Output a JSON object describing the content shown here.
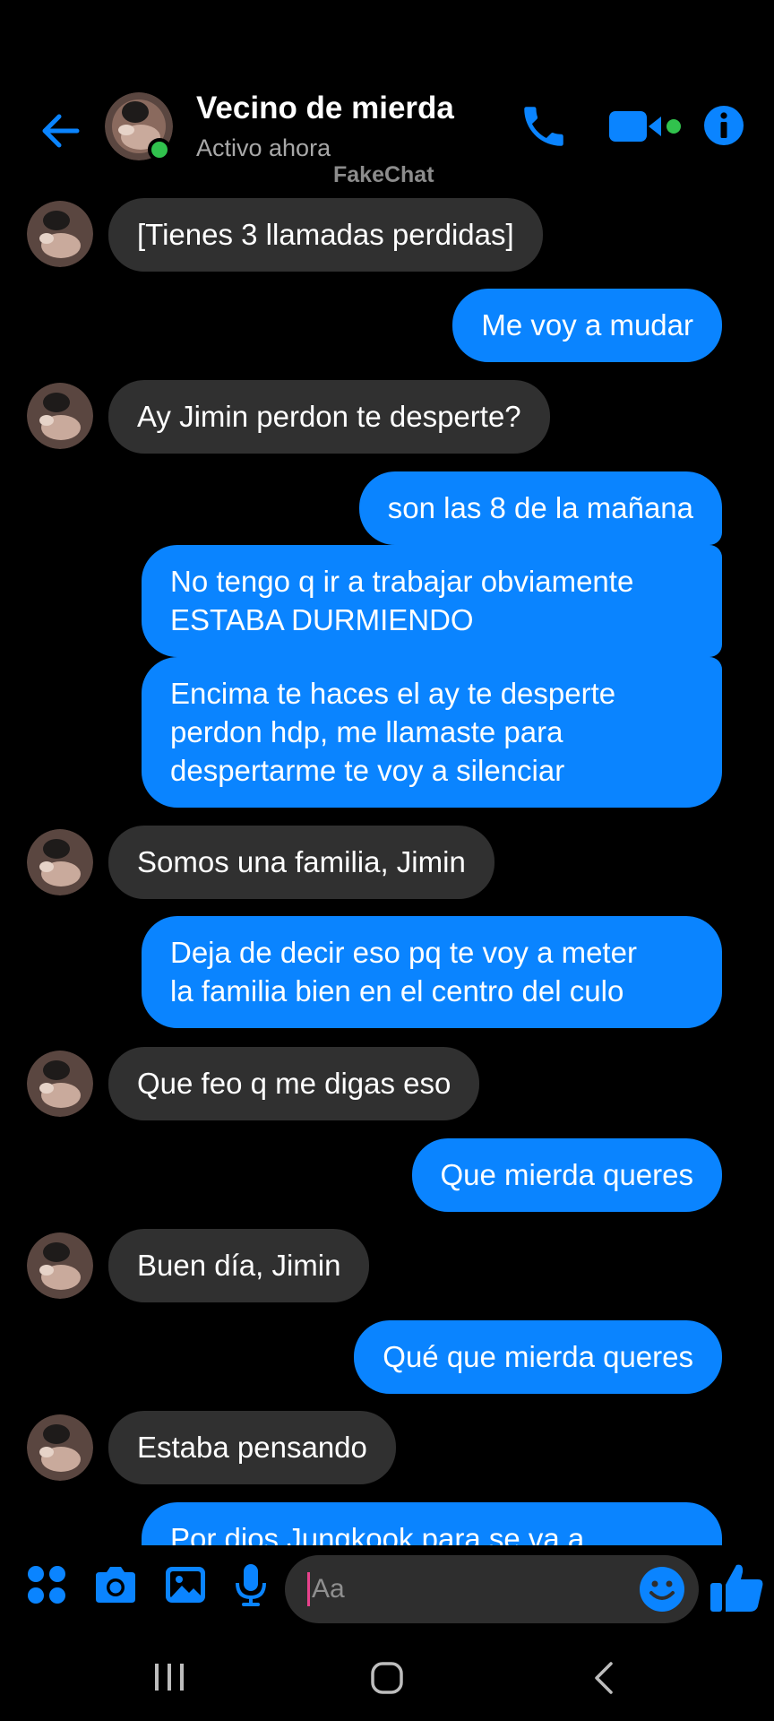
{
  "header": {
    "contact_name": "Vecino de mierda",
    "status": "Activo ahora",
    "watermark": "FakeChat"
  },
  "messages": [
    {
      "side": "in",
      "text": "[Tienes 3 llamadas perdidas]"
    },
    {
      "side": "out",
      "text": "Me voy a mudar"
    },
    {
      "side": "in",
      "text": "Ay Jimin perdon te desperte?"
    },
    {
      "side": "out",
      "text": "son las 8 de la mañana"
    },
    {
      "side": "out",
      "lines": [
        "No tengo q ir a trabajar obviamente",
        "ESTABA DURMIENDO"
      ]
    },
    {
      "side": "out",
      "lines": [
        "Encima te haces el ay te desperte",
        "perdon hdp, me llamaste para",
        "despertarme te voy a silenciar"
      ]
    },
    {
      "side": "in",
      "text": "Somos una familia, Jimin"
    },
    {
      "side": "out",
      "lines": [
        "Deja de decir eso pq te voy a meter",
        "la familia bien en el centro del culo"
      ]
    },
    {
      "side": "in",
      "text": "Que feo q me digas eso"
    },
    {
      "side": "out",
      "text": "Que mierda queres"
    },
    {
      "side": "in",
      "text": "Buen día, Jimin"
    },
    {
      "side": "out",
      "text": "Qué que mierda queres"
    },
    {
      "side": "in",
      "text": "Estaba pensando"
    },
    {
      "side": "out",
      "text": "Por dios Jungkook para se va a"
    }
  ],
  "composer": {
    "placeholder": "Aa",
    "icons": [
      "apps-icon",
      "camera-icon",
      "gallery-icon",
      "microphone-icon",
      "emoji-icon",
      "thumbs-up-icon"
    ]
  },
  "colors": {
    "accent": "#0a84ff",
    "incoming_bubble": "#303030",
    "online": "#31c24d",
    "background": "#000000"
  }
}
